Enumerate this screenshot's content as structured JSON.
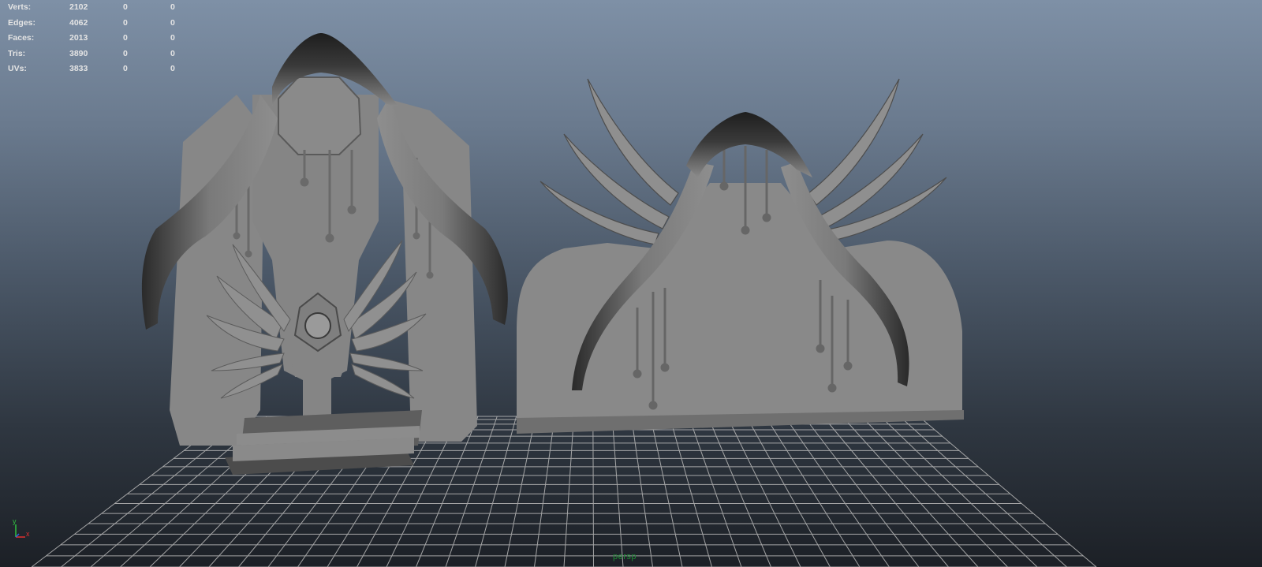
{
  "hud": {
    "rows": [
      {
        "label": "Verts:",
        "value": "2102",
        "sel1": "0",
        "sel2": "0"
      },
      {
        "label": "Edges:",
        "value": "4062",
        "sel1": "0",
        "sel2": "0"
      },
      {
        "label": "Faces:",
        "value": "2013",
        "sel1": "0",
        "sel2": "0"
      },
      {
        "label": "Tris:",
        "value": "3890",
        "sel1": "0",
        "sel2": "0"
      },
      {
        "label": "UVs:",
        "value": "3833",
        "sel1": "0",
        "sel2": "0"
      }
    ]
  },
  "viewport": {
    "camera_label": "persp",
    "axis": {
      "y": "y",
      "x": "x"
    }
  },
  "colors": {
    "bg_top": "#7e90a6",
    "bg_bottom": "#1c2026",
    "mesh": "#878787",
    "grid": "#b0b0b0",
    "axis_x": "#e03030",
    "axis_y": "#30c040",
    "axis_z": "#3060e0"
  },
  "objects": [
    "shrine-arch-mesh",
    "wing-wall-mesh",
    "ground-grid"
  ]
}
